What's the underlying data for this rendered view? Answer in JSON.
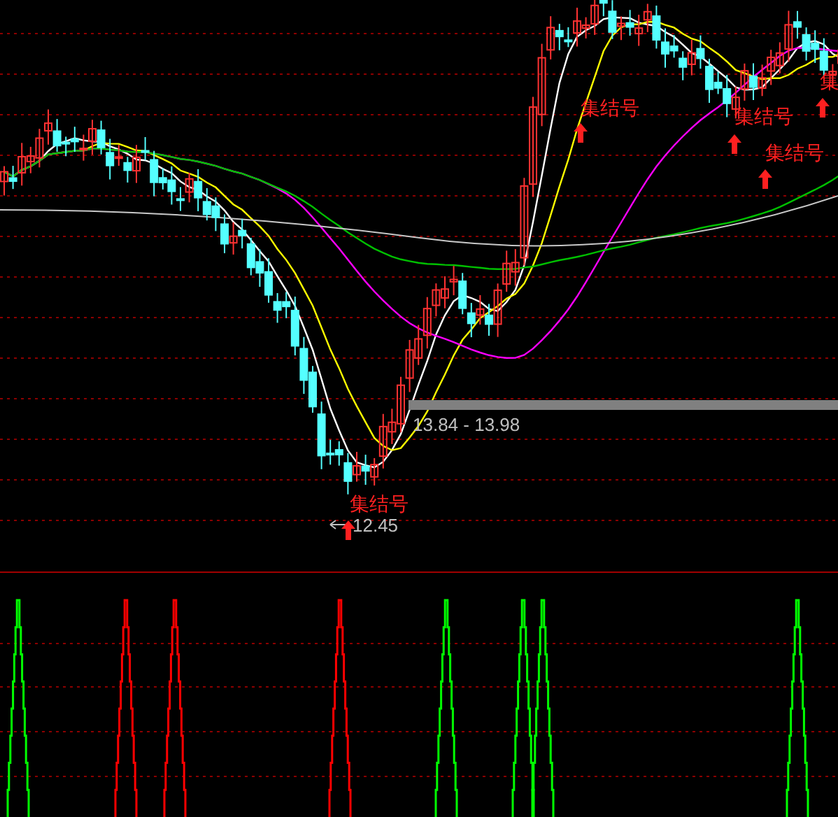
{
  "main_chart": {
    "signals": [
      {
        "label": "集结号"
      },
      {
        "label": "集结号"
      },
      {
        "label": "集结号"
      },
      {
        "label": "集结号"
      },
      {
        "label": "集"
      }
    ],
    "range_label": "13.84 - 13.98",
    "low_label": "12.45"
  },
  "indicator_panel": {
    "spikes": [
      {
        "color": "#00ff00"
      },
      {
        "color": "#ff0000"
      },
      {
        "color": "#ff0000"
      },
      {
        "color": "#ff0000"
      },
      {
        "color": "#00ff00"
      },
      {
        "color": "#00ff00"
      },
      {
        "color": "#00ff00"
      },
      {
        "color": "#00ff00"
      }
    ]
  }
}
